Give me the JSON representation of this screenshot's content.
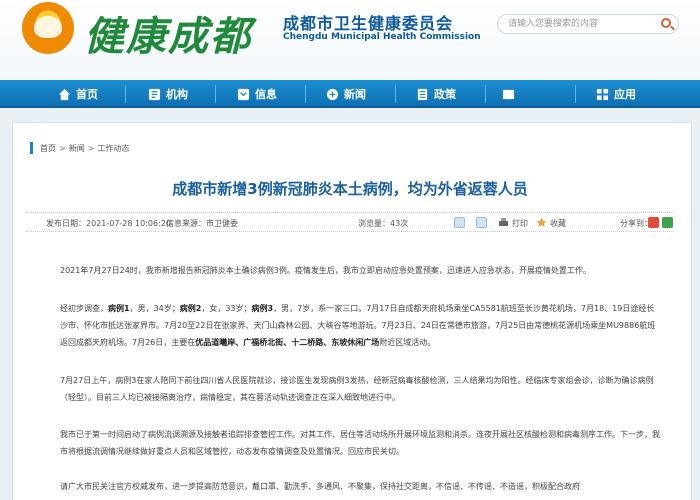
{
  "header": {
    "logo_text": "健康成都",
    "org_cn": "成都市卫生健康委员会",
    "org_en": "Chengdu Municipal Health Commission",
    "search_placeholder": "请输入您要搜索的内容"
  },
  "nav": [
    {
      "label": "首页",
      "icon": "home-icon"
    },
    {
      "label": "机构",
      "icon": "org-icon"
    },
    {
      "label": "信息",
      "icon": "info-icon"
    },
    {
      "label": "新闻",
      "icon": "news-icon"
    },
    {
      "label": "政策",
      "icon": "policy-icon"
    },
    {
      "label": "",
      "icon": "blank-icon"
    },
    {
      "label": "应用",
      "icon": "app-icon"
    }
  ],
  "breadcrumb": [
    "首页",
    "新闻",
    "工作动态"
  ],
  "article": {
    "title": "成都市新增3例新冠肺炎本土病例，均为外省返蓉人员",
    "publish_time": "发布日期：2021-07-28 10:06:20",
    "source": "信息来源：",
    "source_value": "市卫健委",
    "views": "浏览量：43次",
    "print": "打印",
    "favorite": "收藏",
    "share_label": "分享到：",
    "p1": "2021年7月27日24时，我市新增报告新冠肺炎本土确诊病例3例。疫情发生后，我市立即启动应急处置预案，迅速进入应急状态，开展疫情处置工作。",
    "p2_intro": "经初步调查，",
    "p2_case1": "病例1",
    "p2_a": "，男，34岁；",
    "p2_case2": "病例2",
    "p2_b": "，女，33岁；",
    "p2_case3": "病例3",
    "p2_c": "，男，7岁，系一家三口。7月17日自成都天府机场乘坐CA5581航班至长沙黄花机场，7月18、19日途经长沙市、怀化市抵达张家界市。7月20至22日在张家界、天门山森林公园、大峡谷等地游玩。7月23日、24日在常德市旅游，7月25日由常德桃花源机场乘坐MU9886航班返回成都天府机场。7月26日，主要在",
    "p2_places": "优品道曦岸、广福桥北街、十二桥路、东坡休闲广场",
    "p2_end": "附近区域活动。",
    "p3": "7月27日上午，病例3在家人陪同下前往四川省人民医院就诊，接诊医生发现病例3发热，经新冠病毒核酸检测，三人结果均为阳性。经临床专家组会诊，诊断为确诊病例（轻型）。目前三人均已被接隔离治疗，病情稳定，其在蓉活动轨迹调查正在深入细致地进行中。",
    "p4": "我市已于第一时间启动了病例流调溯源及接触者追踪排查管控工作。对其工作、居住等活动场所开展环境监测和消杀。连夜开展社区核酸检测和病毒测序工作。下一步，我市将根据流调情况继续做好重点人员和区域管控，动态发布疫情调查及处置情况。回应市民关切。",
    "p5": "请广大市民关注官方权威发布，进一步提高防范意识，戴口罩、勤洗手、多通风、不聚集，保持社交距离，不信谣、不传谣、不造谣，积极配合政府"
  },
  "colors": {
    "nav_bg": "#1783c9",
    "title": "#1a5f9e",
    "logo_green": "#1f8a3a"
  }
}
